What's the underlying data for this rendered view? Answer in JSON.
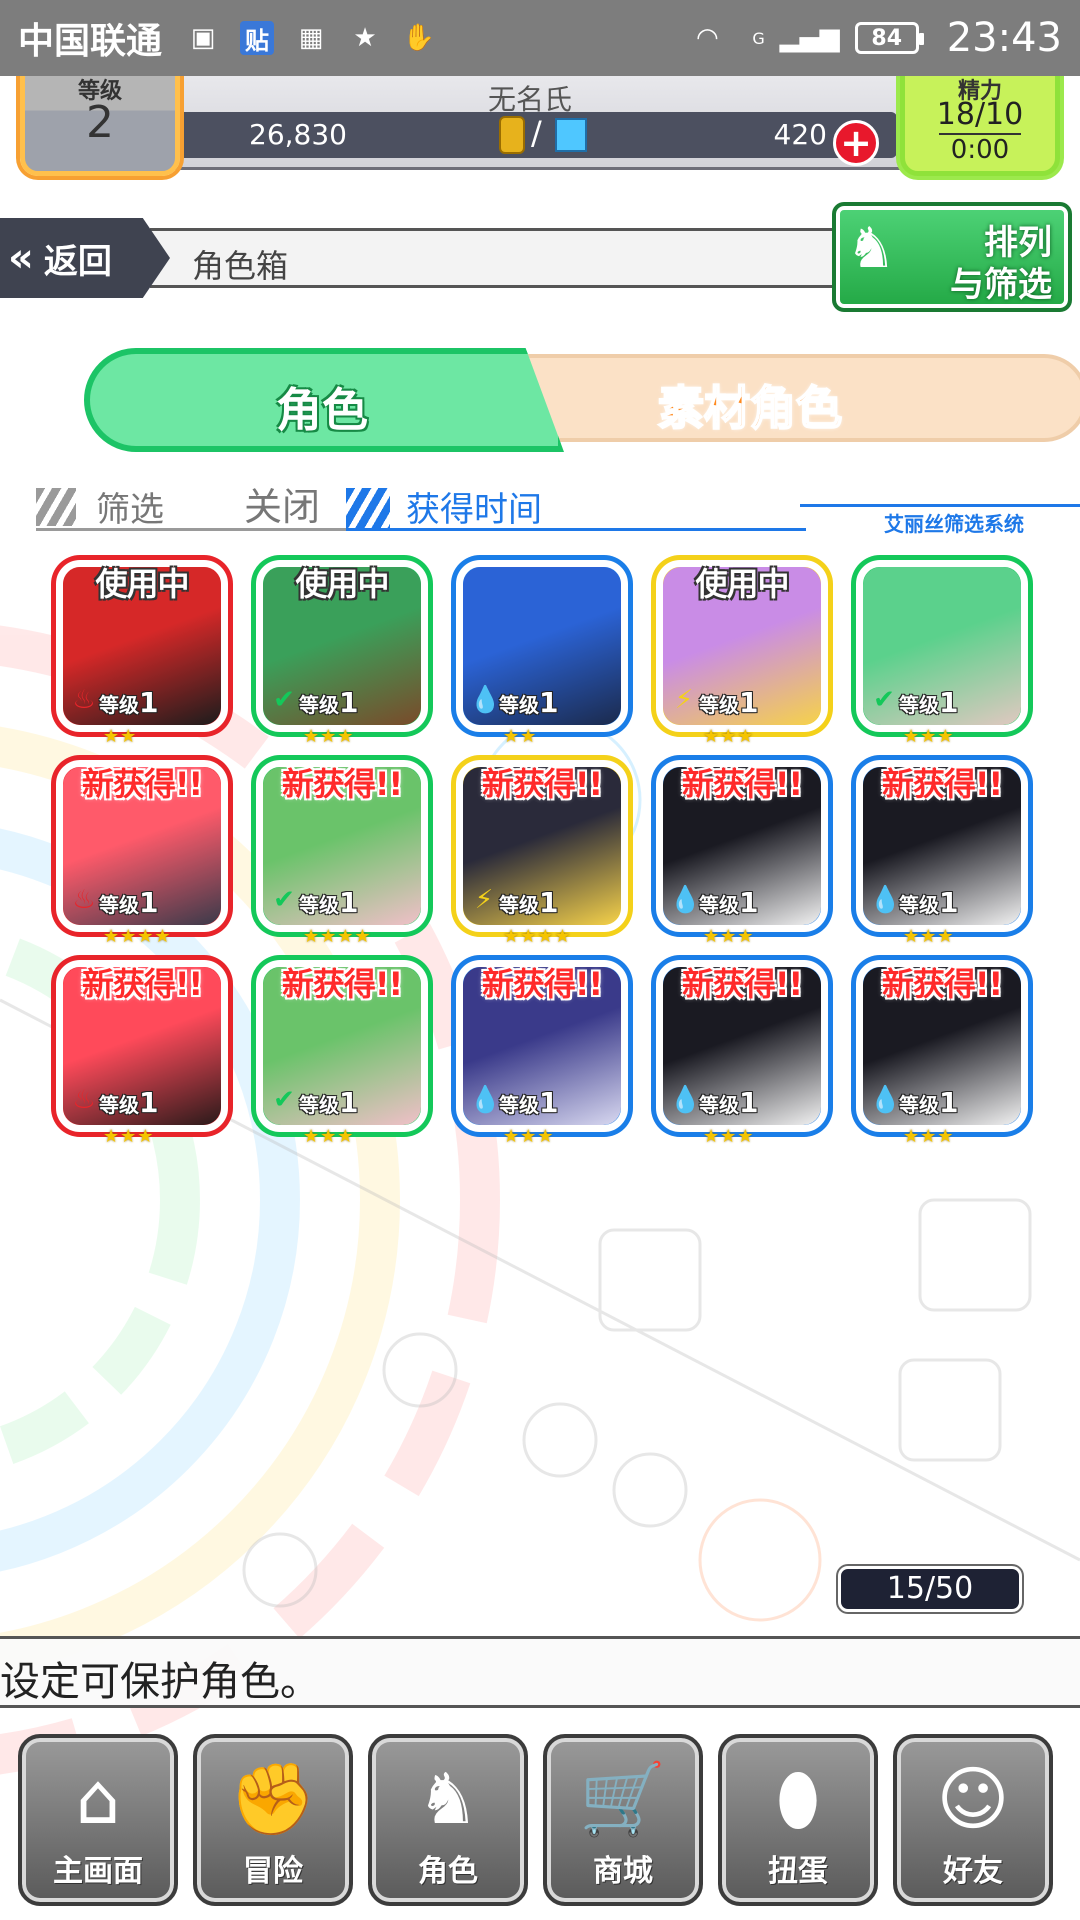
{
  "statusbar": {
    "carrier": "中国联通",
    "tieba_icon_text": "贴",
    "battery": "84",
    "time": "23:43",
    "signal_label": "G"
  },
  "hud": {
    "player_name": "无名氏",
    "level_label": "等级",
    "level": "2",
    "gold": "26,830",
    "crystals": "420",
    "separator": "/",
    "stamina_label": "精力",
    "stamina": "18/10",
    "stamina_timer": "0:00"
  },
  "nav": {
    "back_label": "返回",
    "page_title": "角色箱",
    "sort_filter_line1": "排列",
    "sort_filter_line2": "与筛选"
  },
  "tabs": {
    "characters": "角色",
    "materials": "素材角色"
  },
  "filter": {
    "filter_label": "筛选",
    "filter_value": "关闭",
    "sort_label": "获得时间",
    "system_label": "艾丽丝筛选系统"
  },
  "cards": [
    {
      "badge": "使用中",
      "badge_type": "used",
      "element": "fire",
      "level_label": "等级",
      "level": "1",
      "stars": "★★",
      "frame": "#e8242a",
      "art": [
        "#d62828",
        "#1c1c1c"
      ]
    },
    {
      "badge": "使用中",
      "badge_type": "used",
      "element": "wind",
      "level_label": "等级",
      "level": "1",
      "stars": "★★★",
      "frame": "#14c85a",
      "art": [
        "#3aa05a",
        "#7a4a2a"
      ]
    },
    {
      "badge": "",
      "badge_type": "none",
      "element": "water",
      "level_label": "等级",
      "level": "1",
      "stars": "★★",
      "frame": "#1a7ee8",
      "art": [
        "#2b63d6",
        "#1b2a4c"
      ]
    },
    {
      "badge": "使用中",
      "badge_type": "used",
      "element": "thunder",
      "level_label": "等级",
      "level": "1",
      "stars": "★★★",
      "frame": "#f4d11a",
      "art": [
        "#c98ce6",
        "#f6d24a"
      ]
    },
    {
      "badge": "",
      "badge_type": "none",
      "element": "wind",
      "level_label": "等级",
      "level": "1",
      "stars": "★★★",
      "frame": "#14c85a",
      "art": [
        "#5bd18c",
        "#e0c8c0"
      ]
    },
    {
      "badge": "新获得!!",
      "badge_type": "new",
      "element": "fire",
      "level_label": "等级",
      "level": "1",
      "stars": "★★★★",
      "frame": "#e8242a",
      "art": [
        "#ff5a6a",
        "#3a3a4a"
      ]
    },
    {
      "badge": "新获得!!",
      "badge_type": "new",
      "element": "wind",
      "level_label": "等级",
      "level": "1",
      "stars": "★★★★",
      "frame": "#14c85a",
      "art": [
        "#6ac36a",
        "#f0c0c8"
      ]
    },
    {
      "badge": "新获得!!",
      "badge_type": "new",
      "element": "thunder",
      "level_label": "等级",
      "level": "1",
      "stars": "★★★★",
      "frame": "#f4d11a",
      "art": [
        "#2a2a3a",
        "#f6d24a"
      ]
    },
    {
      "badge": "新获得!!",
      "badge_type": "new",
      "element": "water",
      "level_label": "等级",
      "level": "1",
      "stars": "★★★",
      "frame": "#1a7ee8",
      "art": [
        "#1a1a22",
        "#f2f2f2"
      ]
    },
    {
      "badge": "新获得!!",
      "badge_type": "new",
      "element": "water",
      "level_label": "等级",
      "level": "1",
      "stars": "★★★",
      "frame": "#1a7ee8",
      "art": [
        "#1a1a22",
        "#f2f2f2"
      ]
    },
    {
      "badge": "新获得!!",
      "badge_type": "new",
      "element": "fire",
      "level_label": "等级",
      "level": "1",
      "stars": "★★★",
      "frame": "#e8242a",
      "art": [
        "#ff4a5a",
        "#2a1a1a"
      ]
    },
    {
      "badge": "新获得!!",
      "badge_type": "new",
      "element": "wind",
      "level_label": "等级",
      "level": "1",
      "stars": "★★★",
      "frame": "#14c85a",
      "art": [
        "#6ac36a",
        "#f0c0c8"
      ]
    },
    {
      "badge": "新获得!!",
      "badge_type": "new",
      "element": "water",
      "level_label": "等级",
      "level": "1",
      "stars": "★★★",
      "frame": "#1a7ee8",
      "art": [
        "#3a3a8a",
        "#d8d8f0"
      ]
    },
    {
      "badge": "新获得!!",
      "badge_type": "new",
      "element": "water",
      "level_label": "等级",
      "level": "1",
      "stars": "★★★",
      "frame": "#1a7ee8",
      "art": [
        "#1a1a22",
        "#f2f2f2"
      ]
    },
    {
      "badge": "新获得!!",
      "badge_type": "new",
      "element": "water",
      "level_label": "等级",
      "level": "1",
      "stars": "★★★",
      "frame": "#1a7ee8",
      "art": [
        "#1a1a22",
        "#f2f2f2"
      ]
    }
  ],
  "element_glyphs": {
    "fire": "♨",
    "wind": "✔",
    "water": "💧",
    "thunder": "⚡"
  },
  "count": "15/50",
  "tip": "设定可保护角色。",
  "bottom_nav": [
    {
      "label": "主画面",
      "icon": "home-icon",
      "glyph": "⌂"
    },
    {
      "label": "冒险",
      "icon": "fist-icon",
      "glyph": "✊"
    },
    {
      "label": "角色",
      "icon": "rabbit-icon",
      "glyph": "♞"
    },
    {
      "label": "商城",
      "icon": "cart-icon",
      "glyph": "🛒"
    },
    {
      "label": "扭蛋",
      "icon": "egg-icon",
      "glyph": "⬮"
    },
    {
      "label": "好友",
      "icon": "friends-icon",
      "glyph": "☺"
    }
  ]
}
